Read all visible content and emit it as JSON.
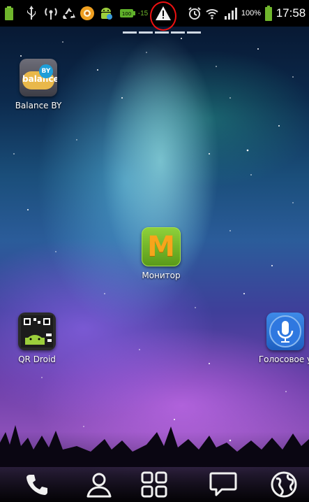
{
  "status_bar": {
    "battery_percent": "100%",
    "time": "17:58",
    "small_counter": "-15",
    "icons": [
      "battery-small-icon",
      "usb-icon",
      "wifi-hotspot-icon",
      "recycle-icon",
      "app-notification-icon",
      "android-icon",
      "battery-100-icon",
      "warning-icon",
      "alarm-icon",
      "wifi-icon",
      "signal-icon",
      "battery-icon"
    ]
  },
  "home_apps": [
    {
      "label": "Balance BY",
      "icon": "balance-by-app-icon"
    },
    {
      "label": "Монитор",
      "icon": "monitor-app-icon",
      "glyph": "M"
    },
    {
      "label": "QR Droid",
      "icon": "qr-droid-app-icon"
    },
    {
      "label": "Голосовое у",
      "icon": "voice-search-app-icon"
    }
  ],
  "balance_icon_text": "balance",
  "balance_badge_text": "BY",
  "dock": {
    "items": [
      "phone-icon",
      "contacts-icon",
      "apps-grid-icon",
      "messages-icon",
      "browser-globe-icon"
    ]
  },
  "colors": {
    "highlight_circle": "#e11111",
    "monitor_icon": "#7ac31f",
    "voice_icon": "#2a7fe0"
  }
}
